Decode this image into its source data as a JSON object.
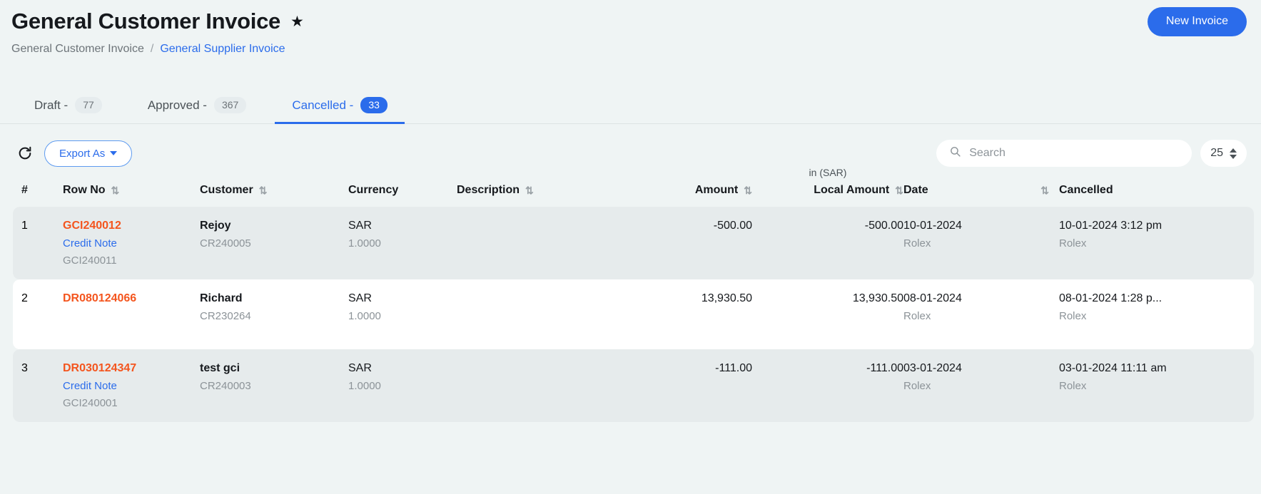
{
  "header": {
    "title": "General Customer Invoice",
    "star_icon": "star-icon",
    "new_invoice_label": "New Invoice",
    "accent_color": "#2b6ceb"
  },
  "breadcrumb": {
    "current": "General Customer Invoice",
    "separator": "/",
    "link": "General Supplier Invoice"
  },
  "tabs": [
    {
      "label": "Draft -",
      "count": "77",
      "active": false
    },
    {
      "label": "Approved -",
      "count": "367",
      "active": false
    },
    {
      "label": "Cancelled -",
      "count": "33",
      "active": true
    }
  ],
  "toolbar": {
    "refresh_icon": "refresh-icon",
    "export_label": "Export As",
    "search_icon": "search-icon",
    "search_placeholder": "Search",
    "search_value": "",
    "page_size": "25"
  },
  "table": {
    "unit_label": "in (SAR)",
    "columns": [
      {
        "label": "#",
        "sortable": false
      },
      {
        "label": "Row No",
        "sortable": true
      },
      {
        "label": "Customer",
        "sortable": true
      },
      {
        "label": "Currency",
        "sortable": false
      },
      {
        "label": "Description",
        "sortable": true
      },
      {
        "label": "Amount",
        "sortable": true
      },
      {
        "label": "Local Amount",
        "sortable": true
      },
      {
        "label": "Date",
        "sortable": true
      },
      {
        "label": "Cancelled",
        "sortable": false
      }
    ],
    "rows": [
      {
        "index": "1",
        "row_no": "GCI240012",
        "doc_link": "Credit Note",
        "doc_ref": "GCI240011",
        "customer": "Rejoy",
        "customer_code": "CR240005",
        "currency": "SAR",
        "rate": "1.0000",
        "description": "",
        "amount": "-500.00",
        "local_amount": "-500.00",
        "date": "10-01-2024",
        "date_user": "Rolex",
        "cancelled": "10-01-2024 3:12 pm",
        "cancelled_user": "Rolex"
      },
      {
        "index": "2",
        "row_no": "DR080124066",
        "doc_link": "",
        "doc_ref": "",
        "customer": "Richard",
        "customer_code": "CR230264",
        "currency": "SAR",
        "rate": "1.0000",
        "description": "",
        "amount": "13,930.50",
        "local_amount": "13,930.50",
        "date": "08-01-2024",
        "date_user": "Rolex",
        "cancelled": "08-01-2024 1:28 p...",
        "cancelled_user": "Rolex"
      },
      {
        "index": "3",
        "row_no": "DR030124347",
        "doc_link": "Credit Note",
        "doc_ref": "GCI240001",
        "customer": "test gci",
        "customer_code": "CR240003",
        "currency": "SAR",
        "rate": "1.0000",
        "description": "",
        "amount": "-111.00",
        "local_amount": "-111.00",
        "date": "03-01-2024",
        "date_user": "Rolex",
        "cancelled": "03-01-2024 11:11 am",
        "cancelled_user": "Rolex"
      }
    ]
  }
}
